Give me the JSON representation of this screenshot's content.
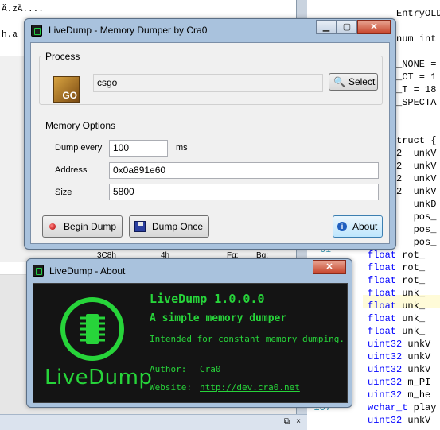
{
  "background": {
    "left_text_lines": [
      "Ä.zÄ....",
      "",
      "",
      "h.a"
    ],
    "hex_row": {
      "c1": "3C8h",
      "c2": "4h",
      "c3": "Fg:",
      "c4": "Bg:"
    },
    "code_lines": [
      {
        "ln": "",
        "text": "EntryOLD;",
        "kw": ""
      },
      {
        "ln": "",
        "text": "num int",
        "kw": ""
      },
      {
        "ln": "",
        "text": "_NONE =",
        "kw": ""
      },
      {
        "ln": "",
        "text": "_CT = 1",
        "kw": ""
      },
      {
        "ln": "",
        "text": "_T = 18",
        "kw": ""
      },
      {
        "ln": "",
        "text": "_SPECTA",
        "kw": ""
      },
      {
        "ln": "",
        "text": "truct {",
        "kw": ""
      },
      {
        "ln": "",
        "text": "2  unkV",
        "kw": ""
      },
      {
        "ln": "",
        "text": "2  unkV",
        "kw": ""
      },
      {
        "ln": "",
        "text": "2  unkV",
        "kw": ""
      },
      {
        "ln": "",
        "text": "2  unkV",
        "kw": ""
      },
      {
        "ln": "",
        "text": "   unkD",
        "kw": ""
      },
      {
        "ln": "",
        "text": "   pos_",
        "kw": ""
      },
      {
        "ln": "",
        "text": "   pos_",
        "kw": ""
      },
      {
        "ln": "",
        "text": "   pos_",
        "kw": ""
      },
      {
        "ln": "",
        "text": "rot_",
        "kw": "float"
      },
      {
        "ln": "",
        "text": "rot_",
        "kw": "float"
      },
      {
        "ln": "",
        "text": "rot_",
        "kw": "float"
      },
      {
        "ln": "",
        "text": "unk_",
        "kw": "float"
      },
      {
        "ln": "",
        "text": "unk_",
        "kw": "float"
      },
      {
        "ln": "",
        "text": "unk_",
        "kw": "float"
      },
      {
        "ln": "",
        "text": "unk_",
        "kw": "float"
      },
      {
        "ln": "",
        "text": "unkV",
        "kw": "uint32"
      },
      {
        "ln": "",
        "text": "unkV",
        "kw": "uint32"
      },
      {
        "ln": "",
        "text": "unkV",
        "kw": "uint32"
      },
      {
        "ln": "",
        "text": "m_PI",
        "kw": "uint32"
      },
      {
        "ln": "",
        "text": "m_he",
        "kw": "uint32"
      },
      {
        "ln": "107",
        "text": "play",
        "kw": "wchar_t"
      },
      {
        "ln": "",
        "text": "unkV",
        "kw": "uint32"
      }
    ],
    "line_no_91": "91"
  },
  "main_window": {
    "title": "LiveDump - Memory Dumper by Cra0",
    "process_group": "Process",
    "process_name": "csgo",
    "process_icon_text": "GO",
    "select_label": "Select",
    "memory_group": "Memory Options",
    "dump_every_label": "Dump every",
    "dump_every_value": "100",
    "ms_label": "ms",
    "address_label": "Address",
    "address_value": "0x0a891e60",
    "size_label": "Size",
    "size_value": "5800",
    "begin_dump": "Begin Dump",
    "dump_once": "Dump Once",
    "about": "About"
  },
  "about_window": {
    "title": "LiveDump - About",
    "logo_text": "LiveDump",
    "name_version": "LiveDump 1.0.0.0",
    "tagline": "A simple memory dumper",
    "description": "Intended for constant memory dumping.",
    "author_label": "Author:",
    "author": "Cra0",
    "website_label": "Website:",
    "website": "http://dev.cra0.net"
  },
  "colors": {
    "accent_green": "#27d43a",
    "about_bg": "#141414",
    "keyword_blue": "#0000ff"
  }
}
